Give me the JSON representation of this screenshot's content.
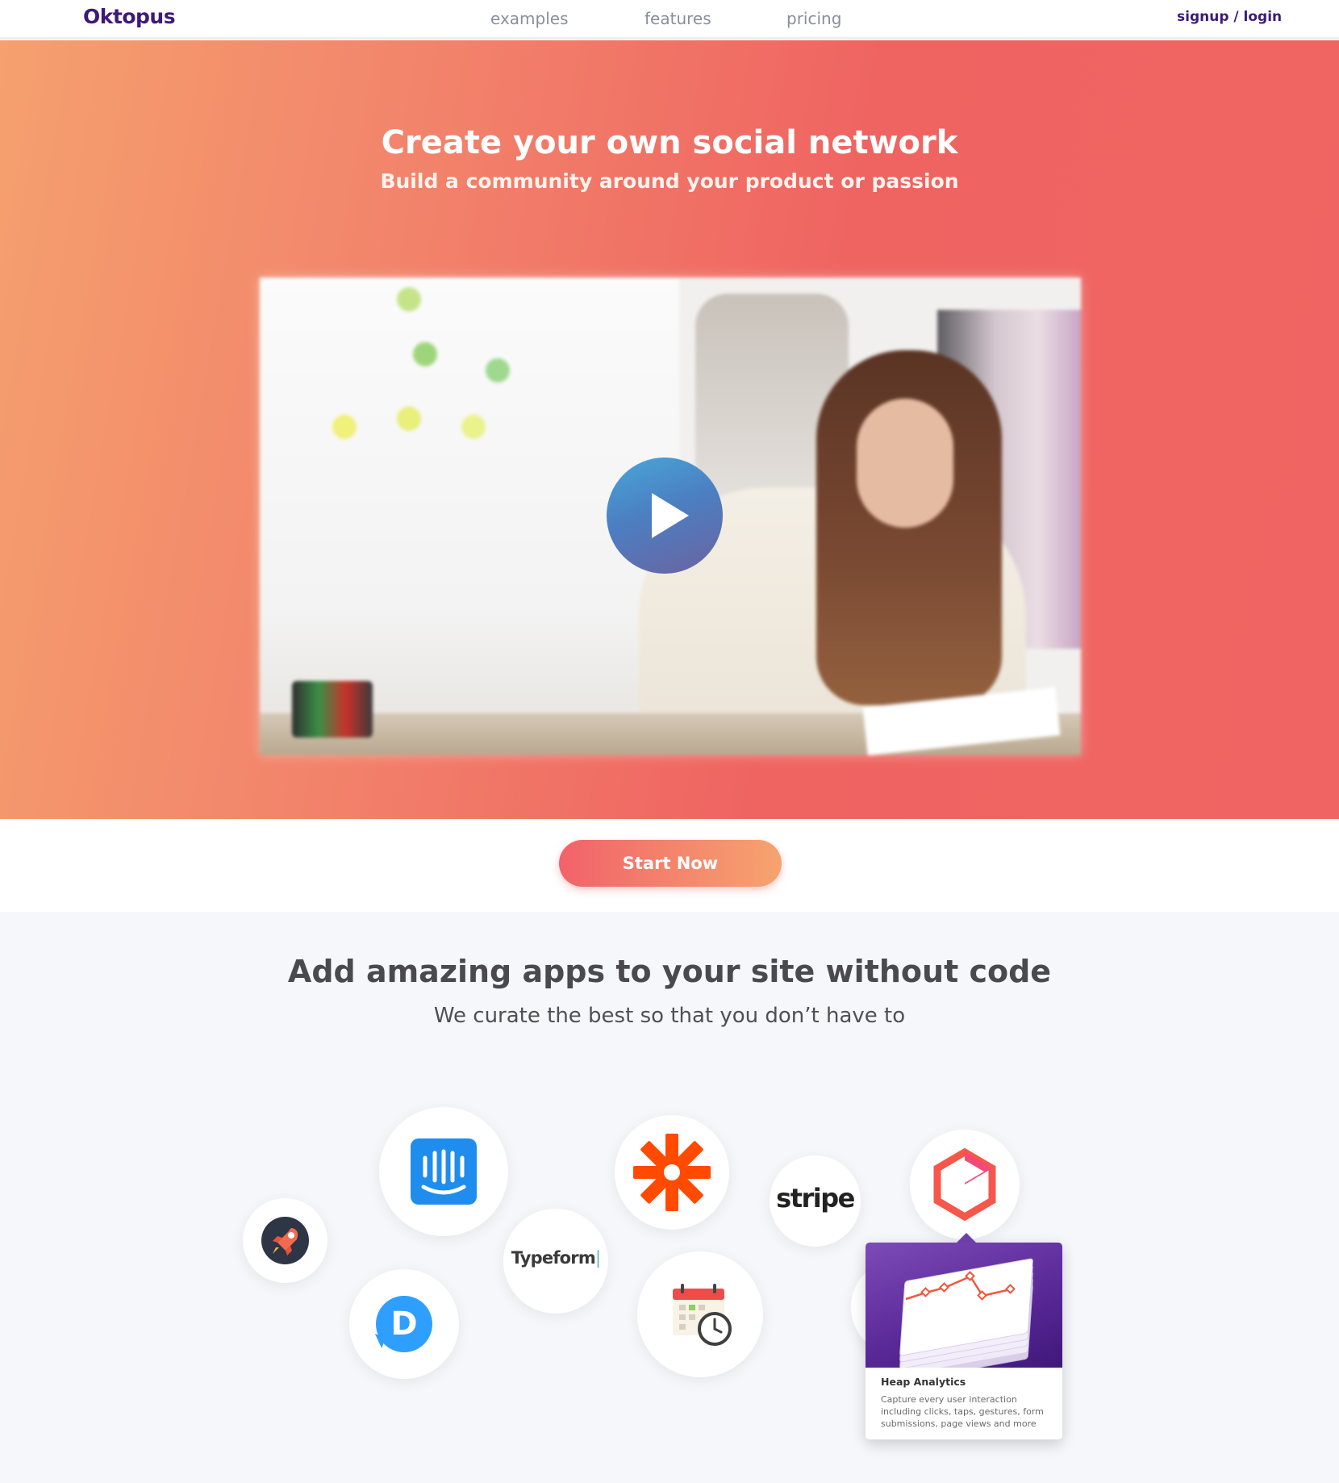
{
  "header": {
    "logo": "Oktopus",
    "nav": [
      "examples",
      "features",
      "pricing"
    ],
    "auth_label": "signup / login"
  },
  "hero": {
    "title": "Create your own social network",
    "subtitle": "Build a community around your product or passion",
    "video_action": "play-icon"
  },
  "cta": {
    "start_label": "Start Now"
  },
  "apps": {
    "title": "Add amazing apps to your site without code",
    "subtitle": "We curate the best so that you don’t have to",
    "logos": [
      {
        "name": "rocket",
        "icon": "rocket-icon"
      },
      {
        "name": "intercom",
        "icon": "intercom-icon"
      },
      {
        "name": "typeform",
        "label": "Typeform"
      },
      {
        "name": "zapier",
        "icon": "zapier-icon"
      },
      {
        "name": "stripe",
        "label": "stripe"
      },
      {
        "name": "heap",
        "icon": "heap-icon"
      },
      {
        "name": "disqus",
        "label": "D"
      },
      {
        "name": "calendar",
        "icon": "calendar-clock-icon"
      }
    ],
    "popup": {
      "title": "Heap Analytics",
      "description": "Capture every user interaction including clicks, taps, gestures, form submissions, page views and more"
    }
  },
  "colors": {
    "brand": "#3e1a78",
    "hero_start": "#f5a06e",
    "hero_end": "#ef6461",
    "intercom": "#1f8ded",
    "zapier": "#ff4a00",
    "disqus": "#2e9fff",
    "heap_purple": "#5b2a99"
  }
}
